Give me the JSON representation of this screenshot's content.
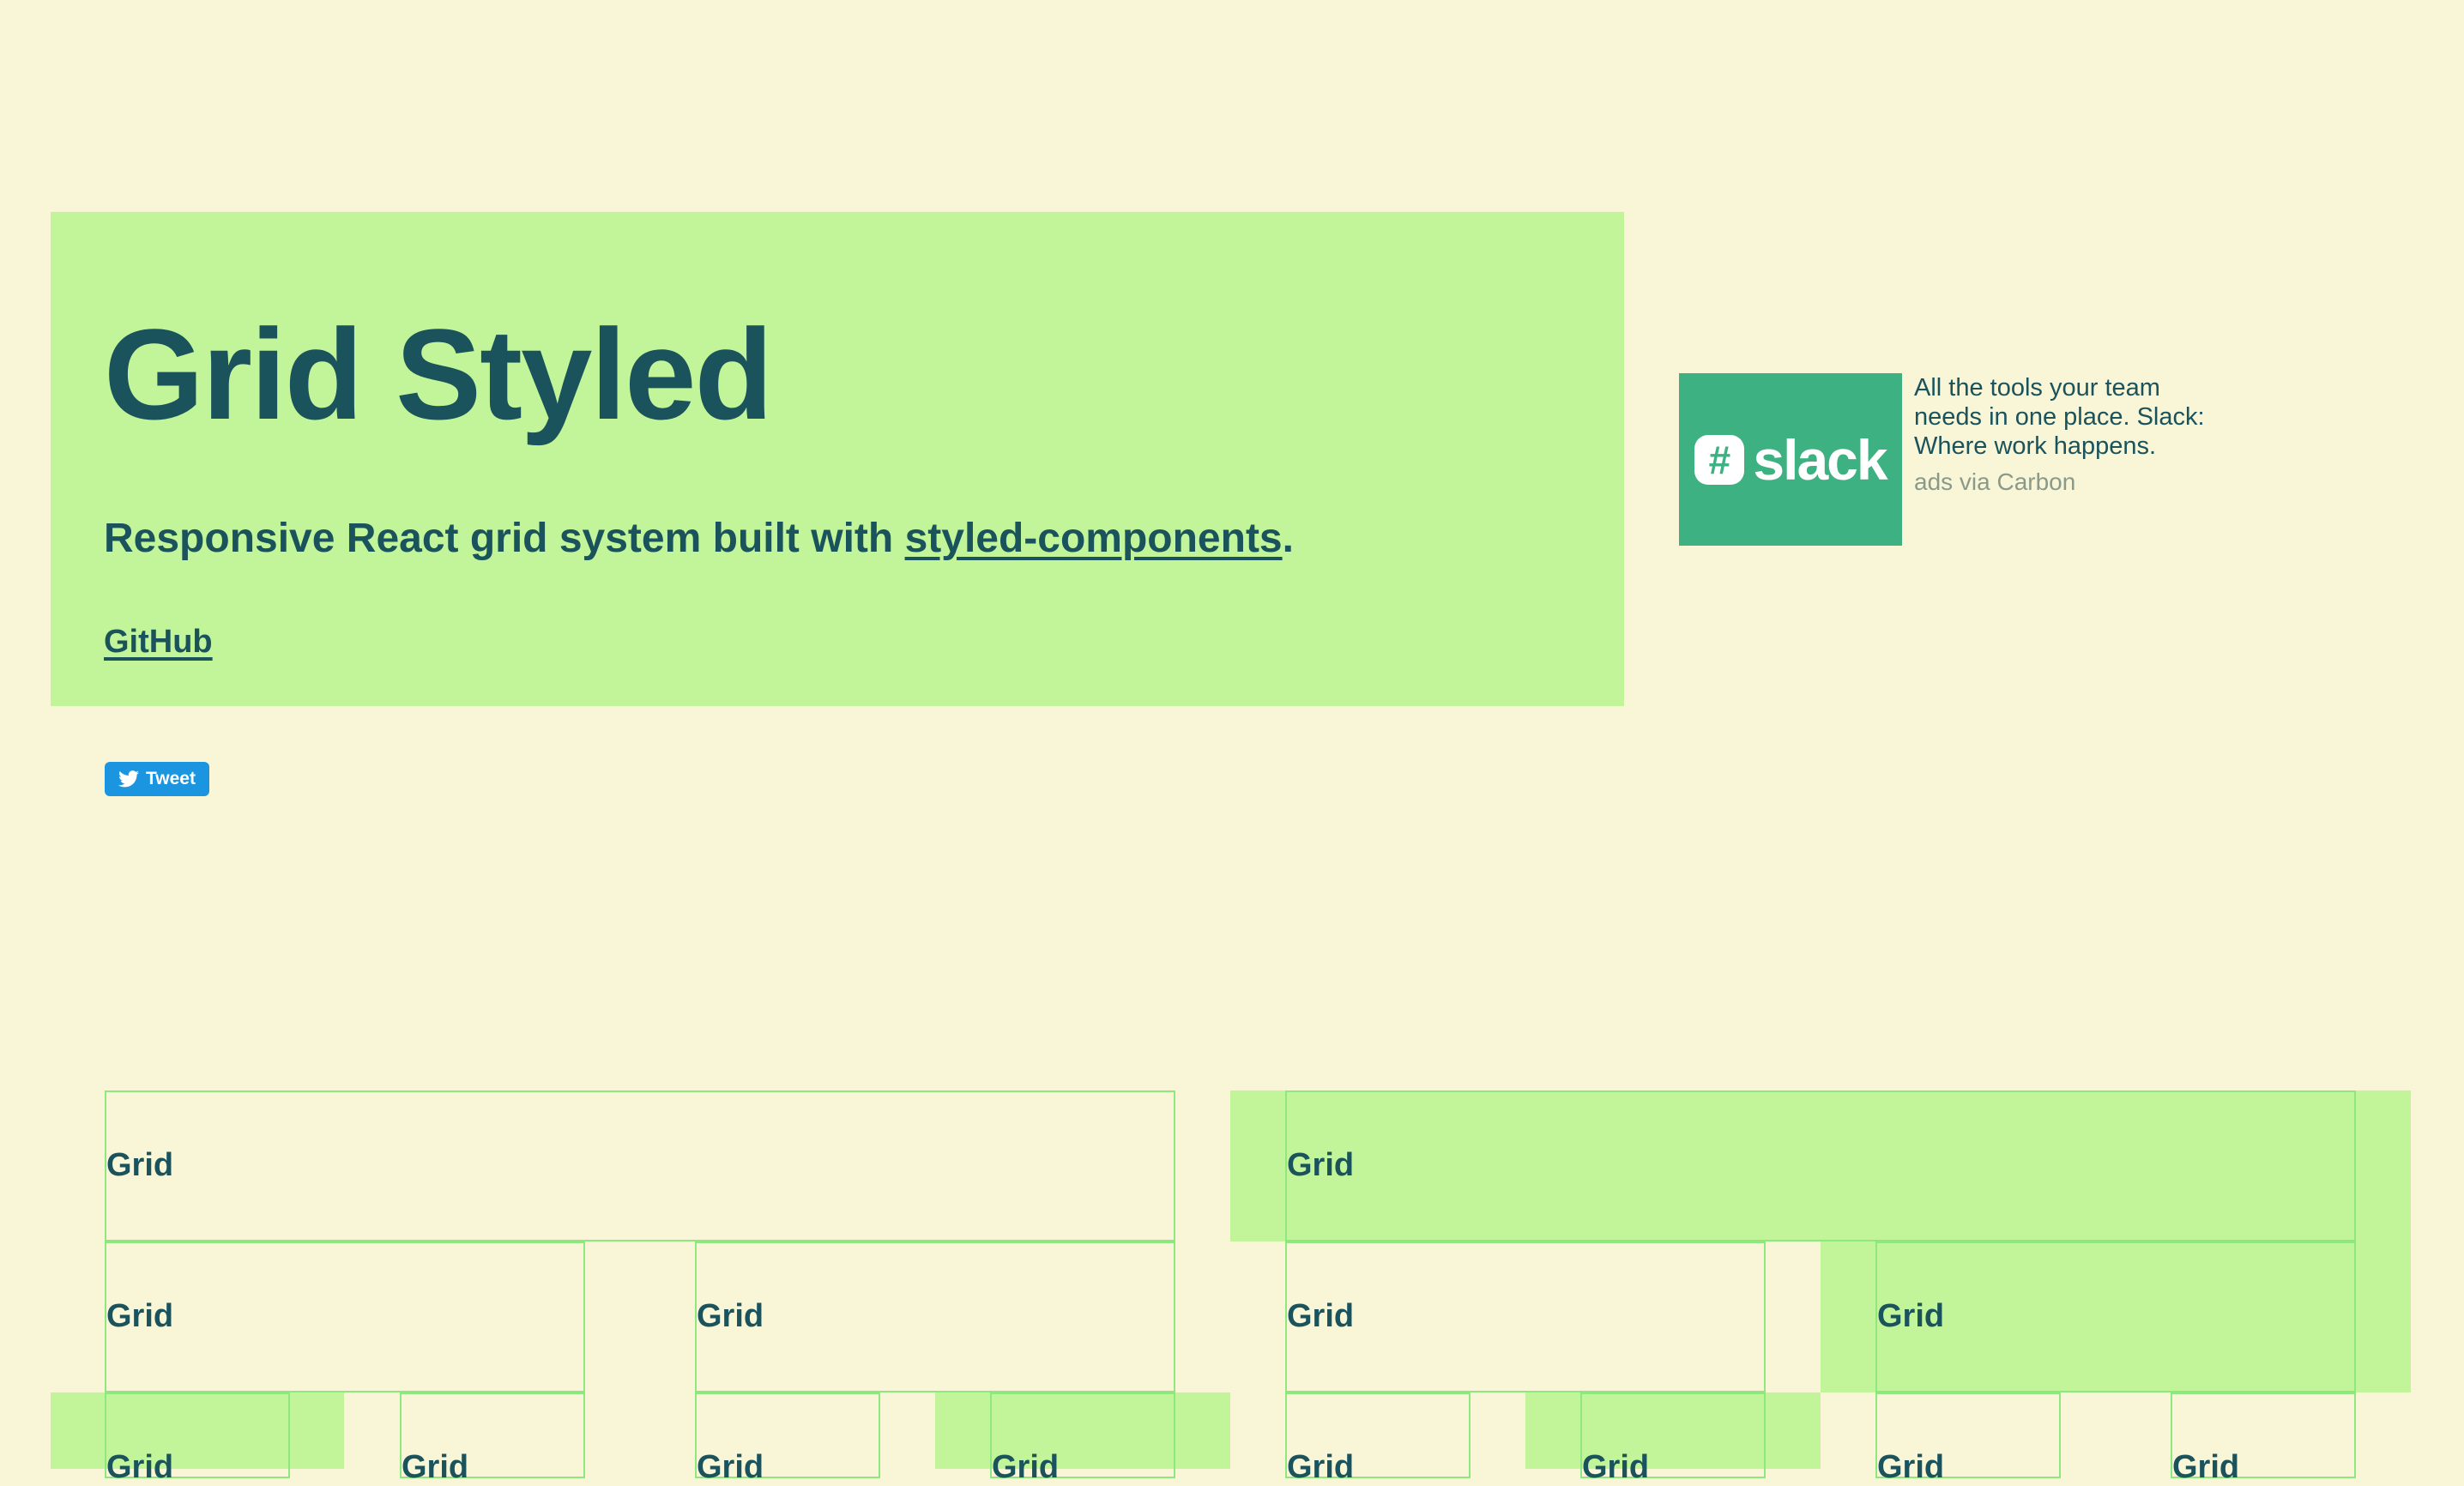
{
  "hero": {
    "title": "Grid Styled",
    "tagline_prefix": "Responsive React grid system built with ",
    "tagline_link": "styled-components",
    "tagline_suffix": ".",
    "github_link": "GitHub"
  },
  "tweet": {
    "label": "Tweet"
  },
  "ad": {
    "brand": "slack",
    "text": "All the tools your team needs in one place. Slack: Where work happens.",
    "via": "ads via Carbon"
  },
  "grid": {
    "label": "Grid"
  },
  "colors": {
    "background": "#f9f5d7",
    "accent": "#c2f59a",
    "text": "#1a535c",
    "border": "#8fe87f",
    "tweet": "#1b95e0",
    "slack": "#3eb183"
  }
}
